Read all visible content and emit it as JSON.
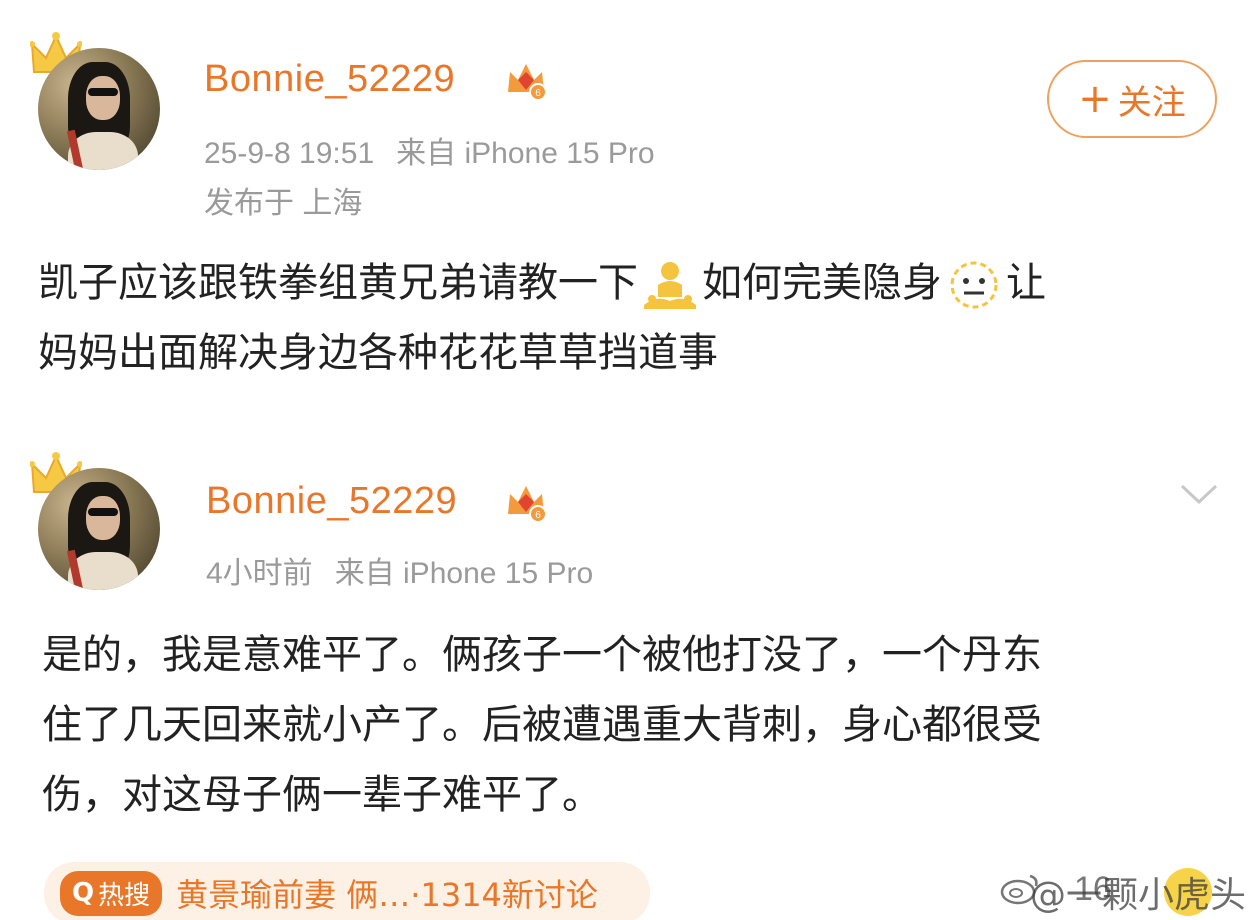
{
  "posts": [
    {
      "username": "Bonnie_52229",
      "meta_line_1": {
        "time": "25-9-8 19:51",
        "source": "来自 iPhone 15 Pro"
      },
      "meta_line_2": "发布于 上海",
      "follow_label": "关注",
      "content": {
        "line1_part1": "凯子应该跟铁拳组黄兄弟请教一下",
        "emoji1": "meditation-emoji",
        "line1_part2": "如何完美隐身",
        "emoji2": "neutral-face-emoji",
        "line1_part3": "让",
        "line2": "妈妈出面解决身边各种花花草草挡道事"
      }
    },
    {
      "username": "Bonnie_52229",
      "meta_line_1": {
        "time": "4小时前",
        "source": "来自 iPhone 15 Pro"
      },
      "content": {
        "line1": "是的，我是意难平了。俩孩子一个被他打没了，一个丹东",
        "line2": "住了几天回来就小产了。后被遭遇重大背刺，身心都很受",
        "line3": "伤，对这母子俩一辈子难平了。"
      }
    }
  ],
  "hot_search": {
    "badge": "热搜",
    "text": "黄景瑜前妻 俩…·1314新讨论"
  },
  "like_count": "16",
  "watermark": "@一颗小虎头",
  "colors": {
    "accent": "#e8772a",
    "meta": "#9a9a9a",
    "hot_bg": "#fdf1e5"
  },
  "icons": [
    "crown-icon",
    "vip-level-icon",
    "chevron-down-icon",
    "like-icon",
    "weibo-logo-icon"
  ]
}
